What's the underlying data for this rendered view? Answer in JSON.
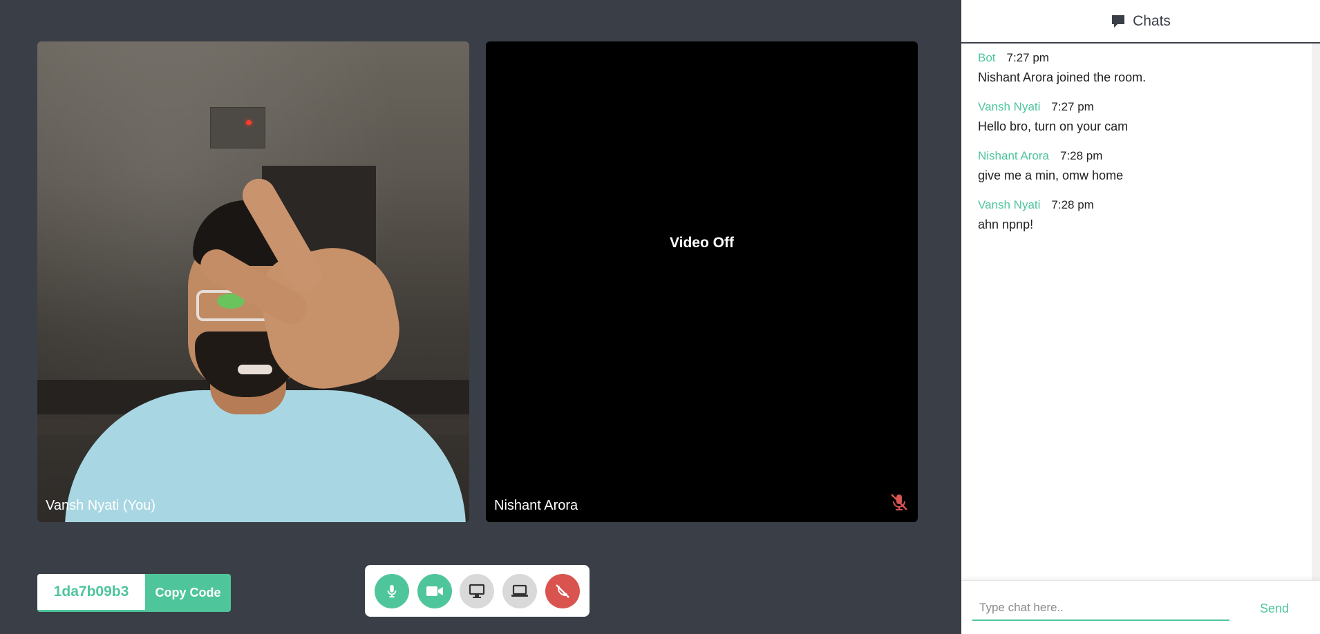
{
  "tiles": {
    "self": {
      "label": "Vansh Nyati (You)"
    },
    "remote": {
      "label": "Nishant Arora",
      "status": "Video Off",
      "mic_icon": "mic-muted-icon",
      "mic_color": "#d9534f"
    }
  },
  "room": {
    "code": "1da7b09b3",
    "copy_label": "Copy Code"
  },
  "controls": [
    {
      "name": "mic-button",
      "icon": "mic-icon"
    },
    {
      "name": "camera-button",
      "icon": "video-camera-icon"
    },
    {
      "name": "screen-share-button",
      "icon": "monitor-icon"
    },
    {
      "name": "laptop-share-button",
      "icon": "laptop-icon"
    },
    {
      "name": "end-call-button",
      "icon": "phone-hangup-icon"
    }
  ],
  "chat": {
    "title": "Chats",
    "messages": [
      {
        "author": "Bot",
        "time": "7:27 pm",
        "text": "Nishant Arora joined the room."
      },
      {
        "author": "Vansh Nyati",
        "time": "7:27 pm",
        "text": "Hello bro, turn on your cam"
      },
      {
        "author": "Nishant Arora",
        "time": "7:28 pm",
        "text": "give me a min, omw home"
      },
      {
        "author": "Vansh Nyati",
        "time": "7:28 pm",
        "text": "ahn npnp!"
      }
    ],
    "input_placeholder": "Type chat here..",
    "send_label": "Send"
  },
  "colors": {
    "accent": "#4fc59b",
    "background": "#3a3f47",
    "danger": "#d9534f"
  }
}
